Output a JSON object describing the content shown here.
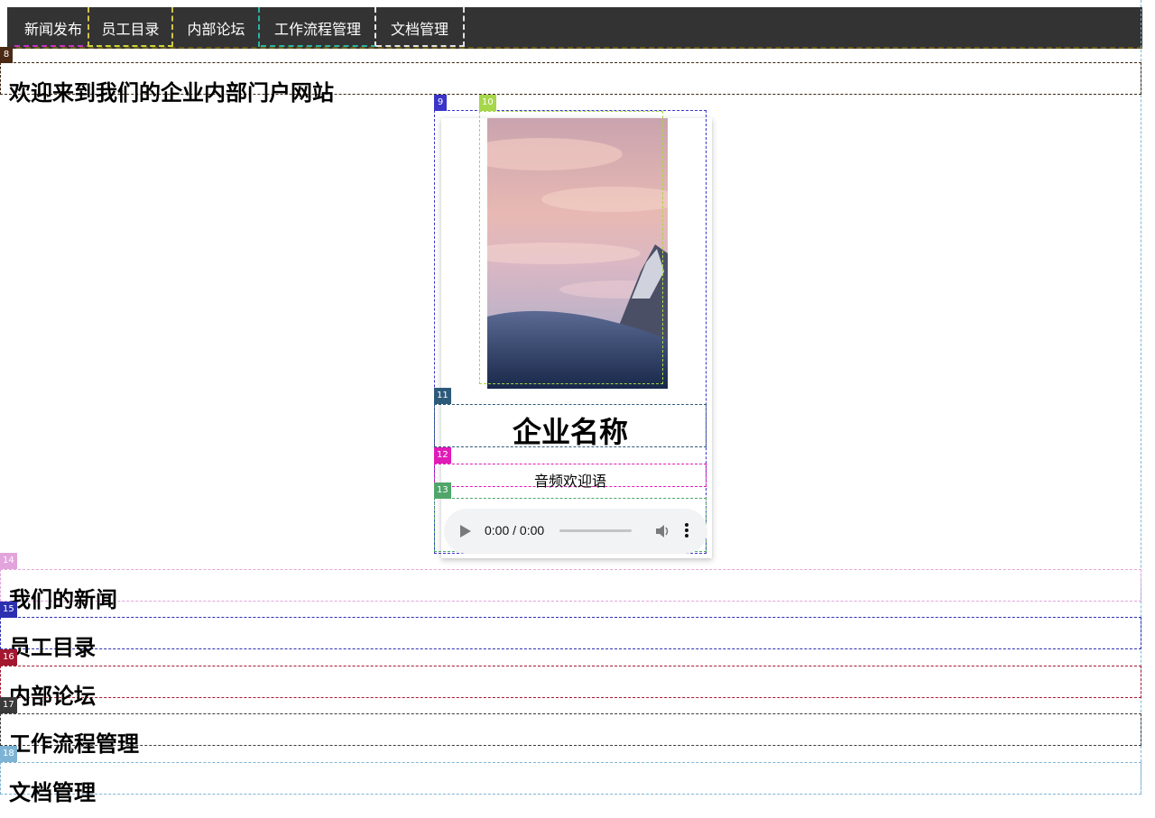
{
  "nav": {
    "items": [
      {
        "label": "新闻发布"
      },
      {
        "label": "员工目录"
      },
      {
        "label": "内部论坛"
      },
      {
        "label": "工作流程管理"
      },
      {
        "label": "文档管理"
      }
    ]
  },
  "welcome": {
    "marker": "8",
    "heading": "欢迎来到我们的企业内部门户网站"
  },
  "card": {
    "markers": {
      "card": "9",
      "photo": "10",
      "name": "11",
      "greeting": "12",
      "audio": "13"
    },
    "photo_alt": "雪山与粉色云彩的风景照片",
    "company_name": "企业名称",
    "audio_greeting": "音频欢迎语",
    "audio": {
      "time": "0:00 / 0:00",
      "progress": 0
    }
  },
  "sections": [
    {
      "marker": "14",
      "heading": "我们的新闻",
      "color": "#e3a3dc"
    },
    {
      "marker": "15",
      "heading": "员工目录",
      "color": "#2b2fb0"
    },
    {
      "marker": "16",
      "heading": "内部论坛",
      "color": "#a3182f"
    },
    {
      "marker": "17",
      "heading": "工作流程管理",
      "color": "#3a3a3a"
    },
    {
      "marker": "18",
      "heading": "文档管理",
      "color": "#7db4d6"
    }
  ],
  "colors": {
    "nav_bg": "#333333",
    "nav_text": "#ffffff",
    "audio_bg": "#f1f3f4"
  }
}
